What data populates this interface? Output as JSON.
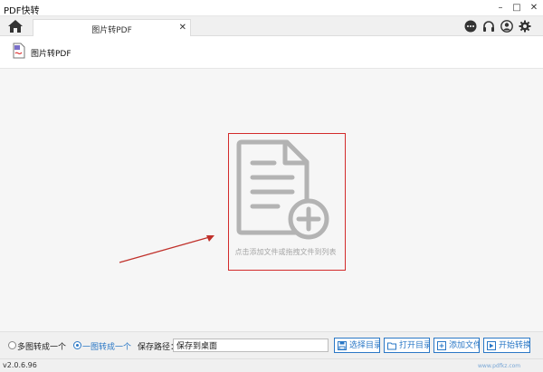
{
  "window": {
    "title": "PDF快转",
    "minimize": "–",
    "maximize": "□",
    "close": "✕"
  },
  "tabs": [
    {
      "label": "图片转PDF",
      "close": "✕"
    }
  ],
  "tool": {
    "title": "图片转PDF"
  },
  "dropzone": {
    "hint": "点击添加文件或拖拽文件到列表"
  },
  "options": {
    "many_to_one": "多图转成一个",
    "one_to_one": "一图转成一个",
    "selected": "one_to_one"
  },
  "save": {
    "label": "保存路径：",
    "value": "保存到桌面"
  },
  "buttons": {
    "choose_dir": "选择目录",
    "open_dir": "打开目录",
    "add_file": "添加文件",
    "start": "开始转换"
  },
  "status": {
    "version": "v2.0.6.96",
    "watermark_url": "www.pdfkz.com"
  },
  "colors": {
    "accent": "#2b78c6",
    "highlight_frame": "#d32b2b",
    "dropzone_icon": "#b3b3b3"
  }
}
